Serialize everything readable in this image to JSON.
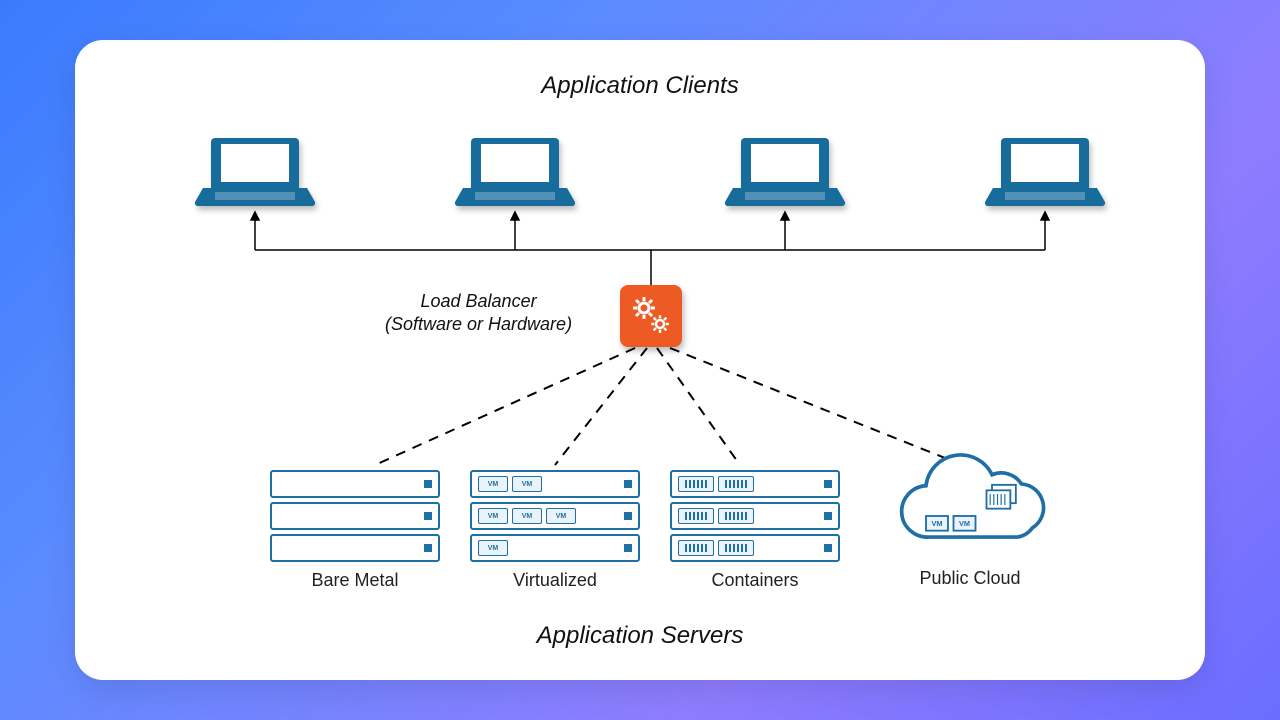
{
  "titles": {
    "clients": "Application Clients",
    "servers": "Application Servers"
  },
  "load_balancer": {
    "label_line1": "Load Balancer",
    "label_line2": "(Software or Hardware)",
    "icon": "gears-icon",
    "color": "#ee5a24"
  },
  "clients": [
    {
      "icon": "laptop-icon"
    },
    {
      "icon": "laptop-icon"
    },
    {
      "icon": "laptop-icon"
    },
    {
      "icon": "laptop-icon"
    }
  ],
  "servers": [
    {
      "label": "Bare Metal",
      "type": "bare"
    },
    {
      "label": "Virtualized",
      "type": "vm"
    },
    {
      "label": "Containers",
      "type": "container"
    },
    {
      "label": "Public Cloud",
      "type": "cloud"
    }
  ],
  "colors": {
    "primary": "#1d6fa5",
    "accent": "#ee5a24"
  }
}
